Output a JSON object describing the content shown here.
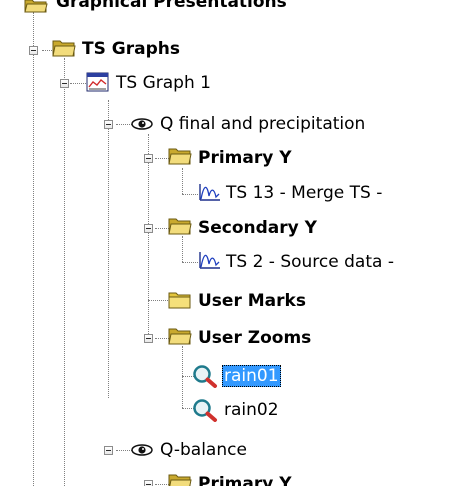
{
  "colors": {
    "selection": "#3399ff",
    "tree_lines": "#808080",
    "folder": "#d8b94b"
  },
  "tree": {
    "items": [
      {
        "label": "Graphical Presentations",
        "icon": "folder-icon",
        "bold": true,
        "expanded": true
      },
      {
        "label": "TS Graphs",
        "icon": "folder-icon",
        "bold": true,
        "expanded": true
      },
      {
        "label": "TS Graph 1",
        "icon": "graph-window-icon",
        "bold": false,
        "expanded": true
      },
      {
        "label": "Q final and precipitation",
        "icon": "eye-icon",
        "bold": false,
        "expanded": true
      },
      {
        "label": "Primary Y",
        "icon": "folder-icon",
        "bold": true,
        "expanded": true
      },
      {
        "label": "TS 13 - Merge TS -",
        "icon": "time-series-icon",
        "bold": false
      },
      {
        "label": "Secondary Y",
        "icon": "folder-icon",
        "bold": true,
        "expanded": true
      },
      {
        "label": "TS 2 - Source data -",
        "icon": "time-series-icon",
        "bold": false
      },
      {
        "label": "User Marks",
        "icon": "folder-icon",
        "bold": true
      },
      {
        "label": "User Zooms",
        "icon": "folder-icon",
        "bold": true,
        "expanded": true
      },
      {
        "label": "rain01",
        "icon": "zoom-icon",
        "bold": false,
        "selected": true
      },
      {
        "label": "rain02",
        "icon": "zoom-icon",
        "bold": false
      },
      {
        "label": "Q-balance",
        "icon": "eye-icon",
        "bold": false,
        "expanded": true
      },
      {
        "label": "Primary Y",
        "icon": "folder-icon",
        "bold": true,
        "expanded": true
      }
    ]
  }
}
